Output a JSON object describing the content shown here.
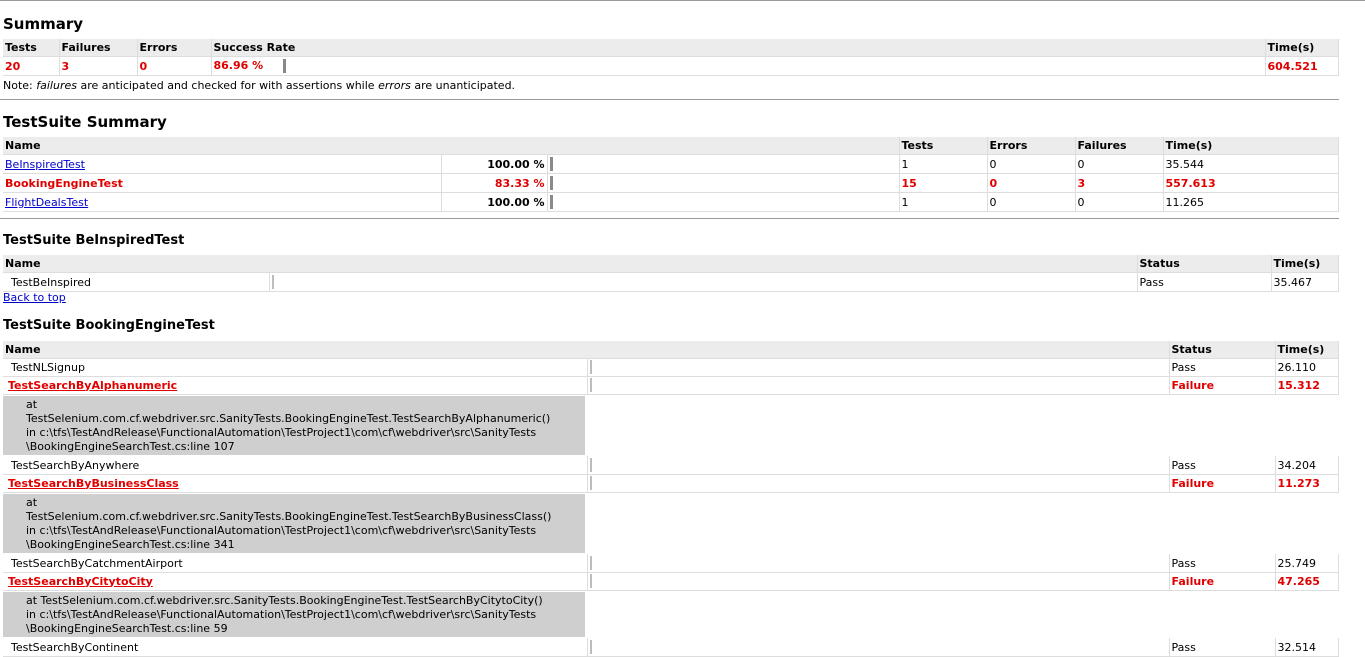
{
  "summary": {
    "heading": "Summary",
    "headers": [
      "Tests",
      "Failures",
      "Errors",
      "Success Rate",
      "Time(s)"
    ],
    "tests": "20",
    "failures": "3",
    "errors": "0",
    "success_rate": "86.96 %",
    "time": "604.521",
    "note_prefix": "Note: ",
    "note_failures": "failures",
    "note_middle": " are anticipated and checked for with assertions while ",
    "note_errors": "errors",
    "note_suffix": " are unanticipated."
  },
  "suite_summary": {
    "heading": "TestSuite Summary",
    "headers": [
      "Name",
      "Tests",
      "Errors",
      "Failures",
      "Time(s)"
    ],
    "rows": [
      {
        "name": "BeInspiredTest",
        "rate": "100.00 %",
        "tests": "1",
        "errors": "0",
        "failures": "0",
        "time": "35.544"
      },
      {
        "name": "BookingEngineTest",
        "rate": "83.33 %",
        "tests": "15",
        "errors": "0",
        "failures": "3",
        "time": "557.613"
      },
      {
        "name": "FlightDealsTest",
        "rate": "100.00 %",
        "tests": "1",
        "errors": "0",
        "failures": "0",
        "time": "11.265"
      }
    ]
  },
  "suite_beinspired": {
    "heading": "TestSuite BeInspiredTest",
    "headers": [
      "Name",
      "Status",
      "Time(s)"
    ],
    "rows": [
      {
        "name": "TestBeInspired",
        "status": "Pass",
        "time": "35.467"
      }
    ],
    "back_to_top": "Back to top"
  },
  "suite_booking": {
    "heading": "TestSuite BookingEngineTest",
    "headers": [
      "Name",
      "Status",
      "Time(s)"
    ],
    "rows": [
      {
        "name": "TestNLSignup",
        "status": "Pass",
        "time": "26.110"
      },
      {
        "name": "TestSearchByAlphanumeric",
        "status": "Failure",
        "time": "15.312",
        "trace": "at\nTestSelenium.com.cf.webdriver.src.SanityTests.BookingEngineTest.TestSearchByAlphanumeric()\nin c:\\tfs\\TestAndRelease\\FunctionalAutomation\\TestProject1\\com\\cf\\webdriver\\src\\SanityTests\n\\BookingEngineSearchTest.cs:line 107"
      },
      {
        "name": "TestSearchByAnywhere",
        "status": "Pass",
        "time": "34.204"
      },
      {
        "name": "TestSearchByBusinessClass",
        "status": "Failure",
        "time": "11.273",
        "trace": "at\nTestSelenium.com.cf.webdriver.src.SanityTests.BookingEngineTest.TestSearchByBusinessClass()\nin c:\\tfs\\TestAndRelease\\FunctionalAutomation\\TestProject1\\com\\cf\\webdriver\\src\\SanityTests\n\\BookingEngineSearchTest.cs:line 341"
      },
      {
        "name": "TestSearchByCatchmentAirport",
        "status": "Pass",
        "time": "25.749"
      },
      {
        "name": "TestSearchByCitytoCity",
        "status": "Failure",
        "time": "47.265",
        "trace": "at TestSelenium.com.cf.webdriver.src.SanityTests.BookingEngineTest.TestSearchByCitytoCity()\nin c:\\tfs\\TestAndRelease\\FunctionalAutomation\\TestProject1\\com\\cf\\webdriver\\src\\SanityTests\n\\BookingEngineSearchTest.cs:line 59"
      },
      {
        "name": "TestSearchByContinent",
        "status": "Pass",
        "time": "32.514"
      }
    ]
  }
}
